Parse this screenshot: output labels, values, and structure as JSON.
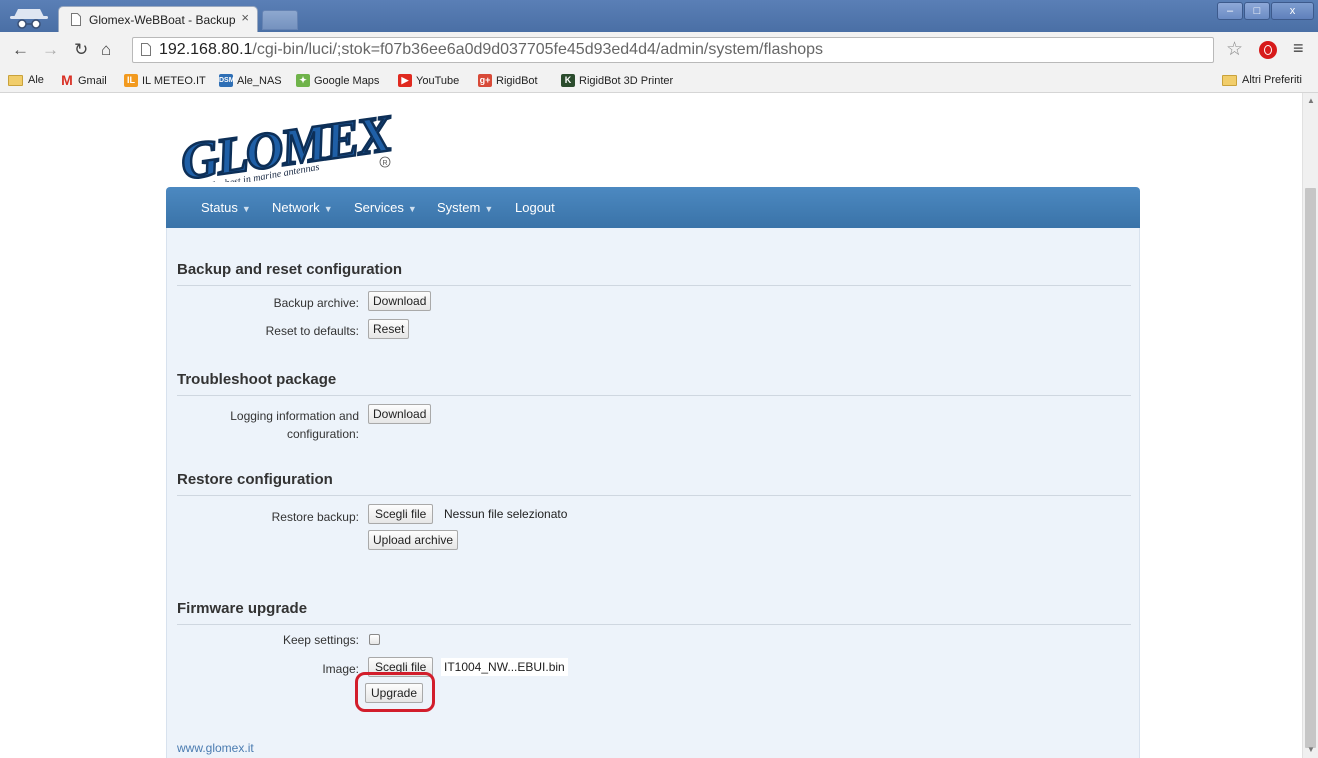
{
  "browser": {
    "tab_title": "Glomex-WeBBoat - Backup",
    "tab_close": "×",
    "window_buttons": [
      "–",
      "□",
      "x"
    ],
    "url_host": "192.168.80.1",
    "url_path": "/cgi-bin/luci/;stok=f07b36ee6a0d9d037705fe45d93ed4d4/admin/system/flashops",
    "bookmarks": [
      {
        "label": "Ale",
        "icon": "folder-icon"
      },
      {
        "label": "Gmail",
        "icon": "gmail-icon"
      },
      {
        "label": "IL METEO.IT",
        "icon": "meteo-icon"
      },
      {
        "label": "Ale_NAS",
        "icon": "nas-icon"
      },
      {
        "label": "Google Maps",
        "icon": "maps-icon"
      },
      {
        "label": "YouTube",
        "icon": "youtube-icon"
      },
      {
        "label": "RigidBot",
        "icon": "google-plus-icon"
      },
      {
        "label": "RigidBot 3D Printer",
        "icon": "rigidbot-icon"
      }
    ],
    "other_bookmarks": "Altri Preferiti"
  },
  "logo": {
    "text": "GLOMEX",
    "tagline": "The best in marine antennas",
    "registered": "®",
    "colors": {
      "letters": "#1f5fa6",
      "outline": "#0d2f57"
    }
  },
  "nav": {
    "items": [
      "Status",
      "Network",
      "Services",
      "System",
      "Logout"
    ],
    "caret": "▼",
    "bar_color": "#3f7ab2"
  },
  "sections": {
    "backup": {
      "title": "Backup and reset configuration",
      "backup_label": "Backup archive:",
      "backup_button": "Download",
      "reset_label": "Reset to defaults:",
      "reset_button": "Reset"
    },
    "troubleshoot": {
      "title": "Troubleshoot package",
      "label_line1": "Logging information and",
      "label_line2": "configuration:",
      "button": "Download"
    },
    "restore": {
      "title": "Restore configuration",
      "label": "Restore backup:",
      "choose_button": "Scegli file",
      "file_status": "Nessun file selezionato",
      "upload_button": "Upload archive"
    },
    "firmware": {
      "title": "Firmware upgrade",
      "keep_label": "Keep settings:",
      "keep_checked": false,
      "image_label": "Image:",
      "choose_button": "Scegli file",
      "file_name": "IT1004_NW...EBUI.bin",
      "upgrade_button": "Upgrade",
      "highlight_color": "#d21d2b"
    }
  },
  "footer": {
    "link": "www.glomex.it"
  }
}
